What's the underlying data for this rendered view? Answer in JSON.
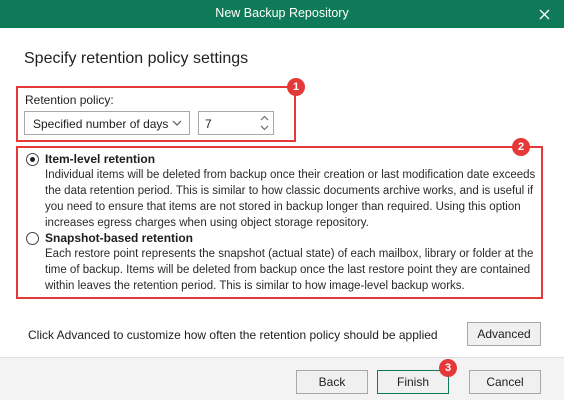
{
  "window": {
    "title": "New Backup Repository"
  },
  "page": {
    "heading": "Specify retention policy settings"
  },
  "retention": {
    "label": "Retention policy:",
    "type_value": "Specified number of days",
    "days_value": "7"
  },
  "options": [
    {
      "title": "Item-level retention",
      "selected": true,
      "description": "Individual items will be deleted from backup once their creation or last modification date exceeds the data retention period. This is similar to how classic documents archive works, and is useful if you need to ensure that items are not stored in backup longer than required. Using this option increases egress charges when using object storage repository."
    },
    {
      "title": "Snapshot-based retention",
      "selected": false,
      "description": "Each restore point represents the snapshot (actual state) of each mailbox, library or folder at the time of backup. Items will be deleted from backup once the last restore point they are contained within leaves the retention period. This is similar to how image-level backup works."
    }
  ],
  "advanced": {
    "hint": "Click Advanced to customize how often the retention policy should be applied",
    "button_label": "Advanced"
  },
  "footer": {
    "back_label": "Back",
    "finish_label": "Finish",
    "cancel_label": "Cancel"
  },
  "annotations": {
    "badge_1": "1",
    "badge_2": "2",
    "badge_3": "3"
  },
  "colors": {
    "titlebar": "#0f7a57",
    "highlight": "#e53939"
  }
}
